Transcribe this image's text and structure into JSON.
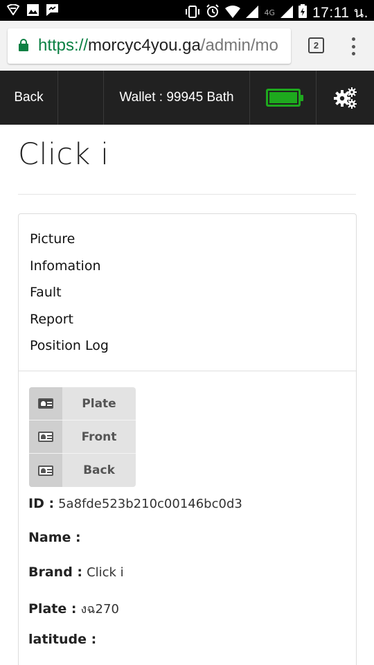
{
  "status_bar": {
    "network": "4G",
    "time": "17:11 น."
  },
  "browser": {
    "url_scheme": "https://",
    "url_host": "morcyc4you.ga",
    "url_path": "/admin/mo",
    "tab_count": "2"
  },
  "navbar": {
    "back_label": "Back",
    "wallet_label": "Wallet : 99945 Bath",
    "battery_level": 1.0,
    "accent_color": "#1ea91e"
  },
  "page": {
    "title": "Click i"
  },
  "menu": {
    "items": [
      {
        "label": "Picture"
      },
      {
        "label": "Infomation"
      },
      {
        "label": "Fault"
      },
      {
        "label": "Report"
      },
      {
        "label": "Position Log"
      }
    ]
  },
  "picture_buttons": [
    {
      "label": "Plate",
      "icon": "id-card-icon"
    },
    {
      "label": "Front",
      "icon": "id-card-icon"
    },
    {
      "label": "Back",
      "icon": "id-card-icon"
    }
  ],
  "details": {
    "id_key": "ID :",
    "id_value": "5a8fde523b210c00146bc0d3",
    "name_key": "Name :",
    "name_value": "",
    "brand_key": "Brand :",
    "brand_value": "Click i",
    "plate_key": "Plate :",
    "plate_value": "งฉ270",
    "latitude_key": "latitude :",
    "latitude_value": ""
  }
}
